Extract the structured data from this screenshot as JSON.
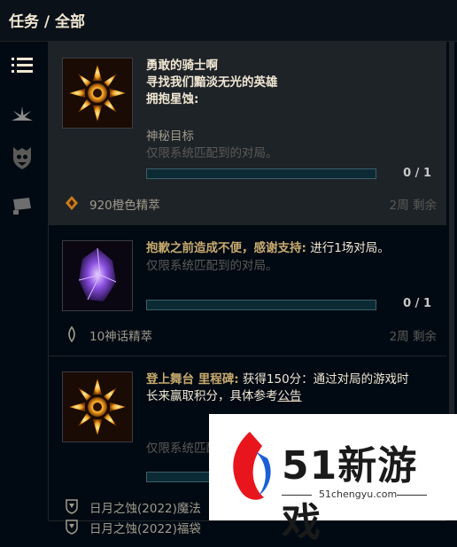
{
  "header": {
    "title": "任务 / 全部"
  },
  "sidebar": {
    "items": [
      {
        "icon": "list-icon",
        "active": true
      },
      {
        "icon": "spark-icon",
        "active": false
      },
      {
        "icon": "crest-icon",
        "active": false
      },
      {
        "icon": "shop-icon",
        "active": false
      }
    ]
  },
  "quests": [
    {
      "title_lines": [
        "勇敢的骑士啊",
        "寻找我们黯淡无光的英雄",
        "拥抱星蚀:"
      ],
      "objective": "神秘目标",
      "restriction": "仅限系统匹配到的对局。",
      "progress": "0 / 1",
      "progress_fraction": 0,
      "reward_icon": "orange-essence-icon",
      "reward": "920橙色精萃",
      "time_left": "2周 剩余"
    },
    {
      "highlight": "抱歉之前造成不便，感谢支持:",
      "desc": " 进行1场对局。",
      "restriction": "仅限系统匹配到的对局。",
      "progress": "0 / 1",
      "progress_fraction": 0,
      "reward_icon": "mythic-essence-icon",
      "reward": "10神话精萃",
      "time_left": "2周 剩余"
    },
    {
      "highlight": "登上舞台 里程碑:",
      "desc": " 获得150分：通过对局的游戏时长来赢取积分，具体参考",
      "link": "公告",
      "restriction": "仅限系统匹配到的对局。",
      "rewards": [
        {
          "icon": "shield-icon",
          "label": "日月之蚀(2022)魔法"
        },
        {
          "icon": "shield-icon",
          "label": "日月之蚀(2022)福袋"
        }
      ]
    }
  ],
  "watermark": {
    "brand": "51新游戏",
    "url": "51chengyu.com"
  }
}
